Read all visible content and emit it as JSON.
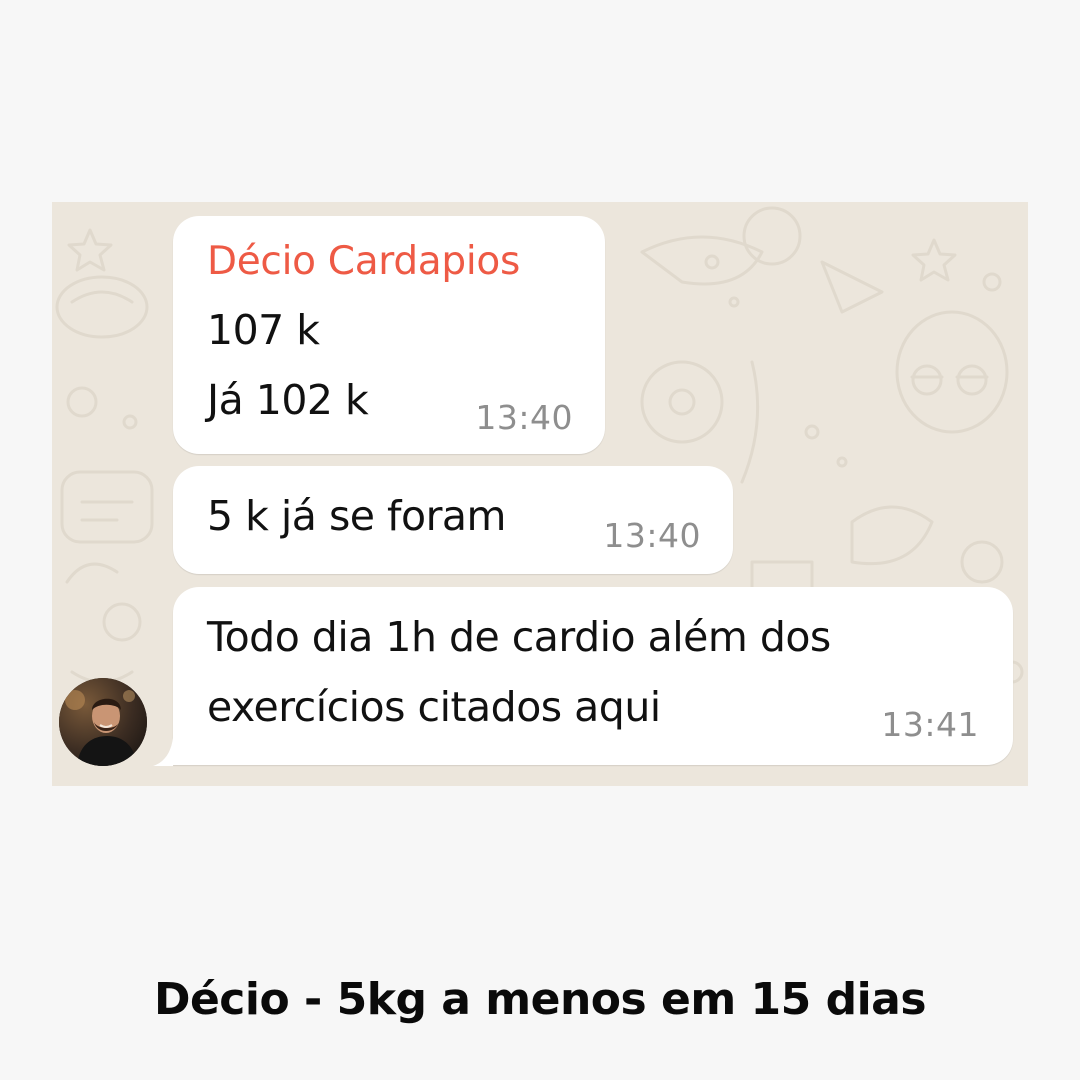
{
  "chat": {
    "messages": [
      {
        "sender": "Décio Cardapios",
        "lines": [
          "107 k",
          "Já 102 k"
        ],
        "time": "13:40"
      },
      {
        "lines": [
          "5 k já se foram"
        ],
        "time": "13:40"
      },
      {
        "lines": [
          "Todo dia 1h de cardio além dos",
          "exercícios citados aqui"
        ],
        "time": "13:41"
      }
    ],
    "avatar_icon": "user-photo",
    "colors": {
      "sender_name": "#ee5a45",
      "bubble": "#ffffff",
      "wallpaper": "#ece6dc",
      "timestamp": "#8e8e8e"
    }
  },
  "caption": "Décio - 5kg a menos em 15 dias"
}
